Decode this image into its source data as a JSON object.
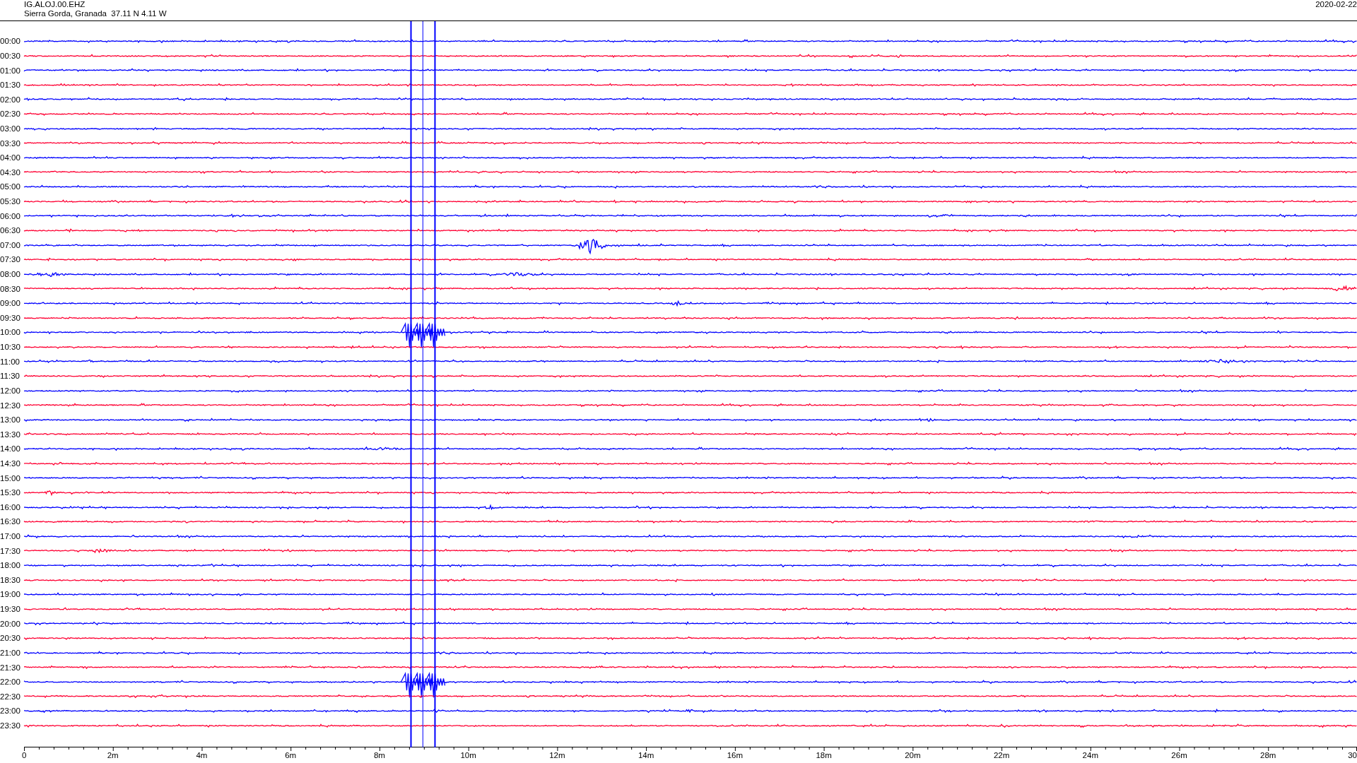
{
  "header": {
    "station": "IG.ALOJ.00.EHZ",
    "location": "Sierra Gorda, Granada  37.11 N 4.11 W",
    "date": "2020-02-22"
  },
  "traces": [
    {
      "time": "00:00",
      "color": "#0000ff"
    },
    {
      "time": "00:30",
      "color": "#ff0033"
    },
    {
      "time": "01:00",
      "color": "#0000ff"
    },
    {
      "time": "01:30",
      "color": "#ff0033"
    },
    {
      "time": "02:00",
      "color": "#0000ff"
    },
    {
      "time": "02:30",
      "color": "#ff0033"
    },
    {
      "time": "03:00",
      "color": "#0000ff"
    },
    {
      "time": "03:30",
      "color": "#ff0033"
    },
    {
      "time": "04:00",
      "color": "#0000ff"
    },
    {
      "time": "04:30",
      "color": "#ff0033"
    },
    {
      "time": "05:00",
      "color": "#0000ff"
    },
    {
      "time": "05:30",
      "color": "#ff0033"
    },
    {
      "time": "06:00",
      "color": "#0000ff"
    },
    {
      "time": "06:30",
      "color": "#ff0033"
    },
    {
      "time": "07:00",
      "color": "#0000ff"
    },
    {
      "time": "07:30",
      "color": "#ff0033"
    },
    {
      "time": "08:00",
      "color": "#0000ff"
    },
    {
      "time": "08:30",
      "color": "#ff0033"
    },
    {
      "time": "09:00",
      "color": "#0000ff"
    },
    {
      "time": "09:30",
      "color": "#ff0033"
    },
    {
      "time": "10:00",
      "color": "#0000ff"
    },
    {
      "time": "10:30",
      "color": "#ff0033"
    },
    {
      "time": "11:00",
      "color": "#0000ff"
    },
    {
      "time": "11:30",
      "color": "#ff0033"
    },
    {
      "time": "12:00",
      "color": "#0000ff"
    },
    {
      "time": "12:30",
      "color": "#ff0033"
    },
    {
      "time": "13:00",
      "color": "#0000ff"
    },
    {
      "time": "13:30",
      "color": "#ff0033"
    },
    {
      "time": "14:00",
      "color": "#0000ff"
    },
    {
      "time": "14:30",
      "color": "#ff0033"
    },
    {
      "time": "15:00",
      "color": "#0000ff"
    },
    {
      "time": "15:30",
      "color": "#ff0033"
    },
    {
      "time": "16:00",
      "color": "#0000ff"
    },
    {
      "time": "16:30",
      "color": "#ff0033"
    },
    {
      "time": "17:00",
      "color": "#0000ff"
    },
    {
      "time": "17:30",
      "color": "#ff0033"
    },
    {
      "time": "18:00",
      "color": "#0000ff"
    },
    {
      "time": "18:30",
      "color": "#ff0033"
    },
    {
      "time": "19:00",
      "color": "#0000ff"
    },
    {
      "time": "19:30",
      "color": "#ff0033"
    },
    {
      "time": "20:00",
      "color": "#0000ff"
    },
    {
      "time": "20:30",
      "color": "#ff0033"
    },
    {
      "time": "21:00",
      "color": "#0000ff"
    },
    {
      "time": "21:30",
      "color": "#ff0033"
    },
    {
      "time": "22:00",
      "color": "#0000ff"
    },
    {
      "time": "22:30",
      "color": "#ff0033"
    },
    {
      "time": "23:00",
      "color": "#0000ff"
    },
    {
      "time": "23:30",
      "color": "#ff0033"
    }
  ],
  "x_axis": {
    "labels": [
      "0",
      "2m",
      "4m",
      "6m",
      "8m",
      "10m",
      "12m",
      "14m",
      "16m",
      "18m",
      "20m",
      "22m",
      "24m",
      "26m",
      "28m",
      "30"
    ]
  }
}
